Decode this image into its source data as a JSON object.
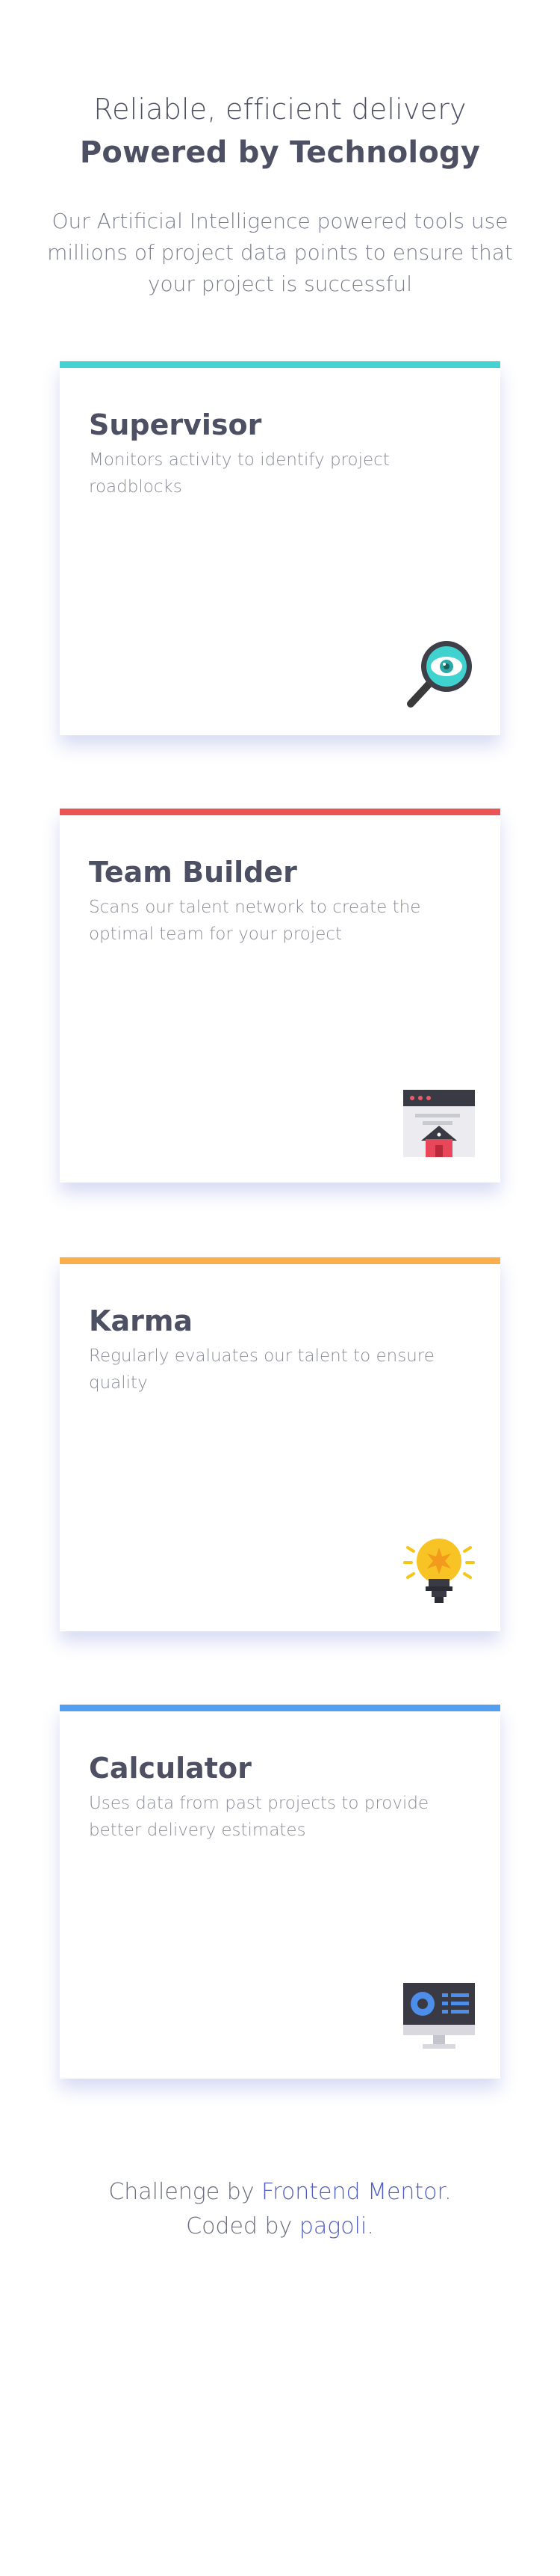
{
  "header": {
    "line1": "Reliable, efficient delivery",
    "line2": "Powered by Technology"
  },
  "intro": {
    "lines": [
      "Our Artificial Intelligence powered tools use",
      "millions of project data points to ensure that",
      "your project is successful"
    ]
  },
  "cards": [
    {
      "title": "Supervisor",
      "desc": "Monitors activity to identify project roadblocks",
      "accent": "#44d3d2",
      "icon": "magnifier-eye-icon"
    },
    {
      "title": "Team Builder",
      "desc": "Scans our talent network to create the optimal team for your project",
      "accent": "#ea5454",
      "icon": "browser-house-icon"
    },
    {
      "title": "Karma",
      "desc": "Regularly evaluates our talent to ensure quality",
      "accent": "#fcae4a",
      "icon": "lightbulb-icon"
    },
    {
      "title": "Calculator",
      "desc": "Uses data from past projects to provide better delivery estimates",
      "accent": "#549ef2",
      "icon": "monitor-chart-icon"
    }
  ],
  "footer": {
    "challenge_prefix": "Challenge by",
    "challenge_link": "Frontend Mentor",
    "challenge_suffix": ".",
    "coded_prefix": "Coded by",
    "coded_link": "pagoli",
    "coded_suffix": "."
  }
}
